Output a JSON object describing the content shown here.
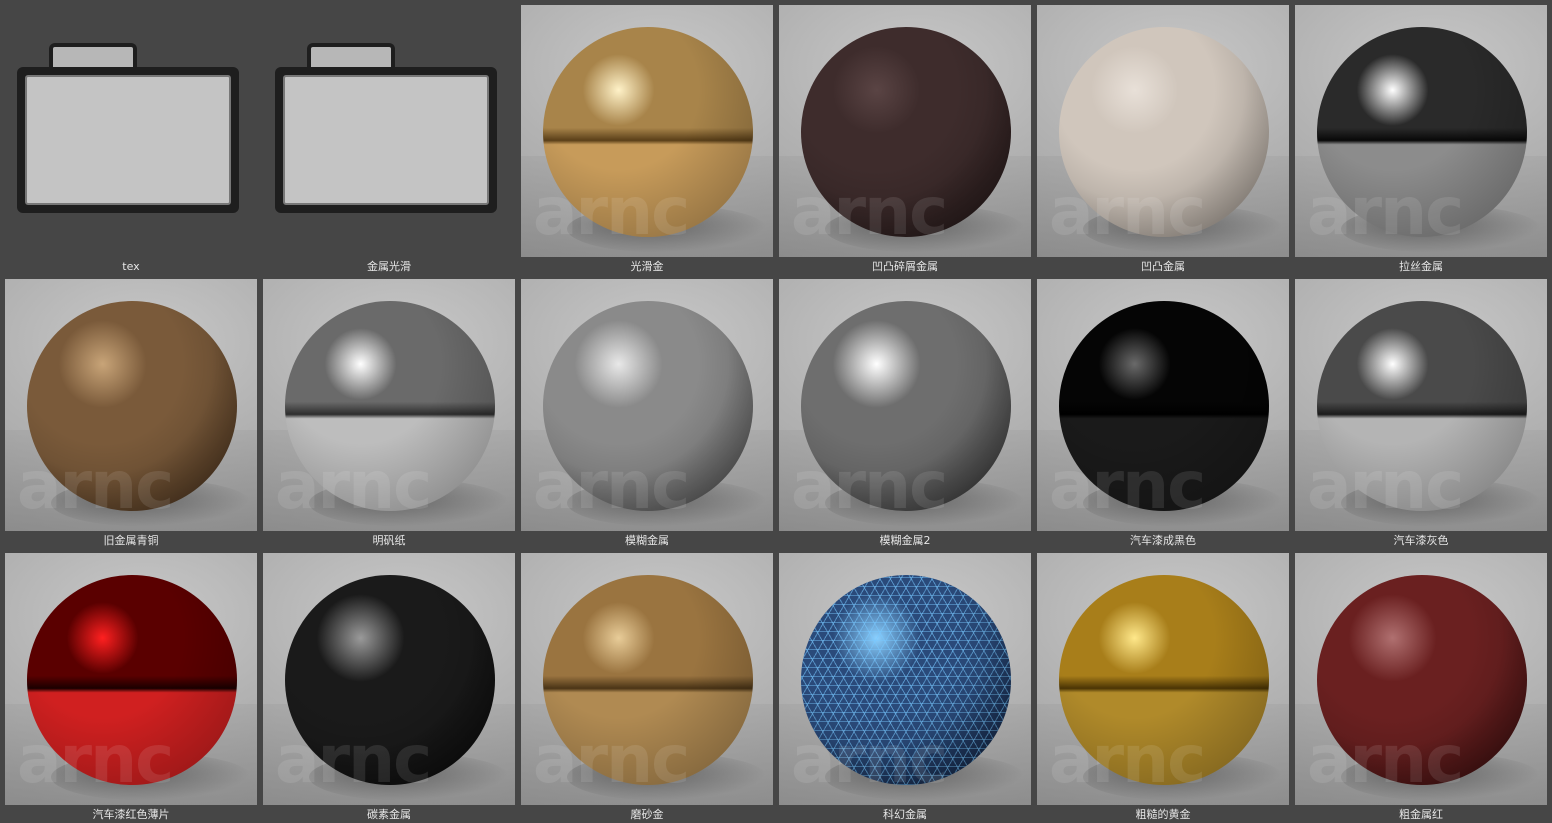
{
  "materials": [
    {
      "label": "tex",
      "kind": "folder",
      "icon": "folder-icon"
    },
    {
      "label": "金属光滑",
      "kind": "folder",
      "icon": "folder-icon"
    },
    {
      "label": "光滑金",
      "kind": "sphere",
      "base": "#a8844a",
      "dark": "#5a3f18",
      "hl": "#fff2c8",
      "bottom": "#c79b5a",
      "split": true
    },
    {
      "label": "凹凸碎屑金属",
      "kind": "sphere",
      "base": "#3e2c2c",
      "dark": "#1a1010",
      "hl": "#5a4444",
      "bottom": "#3e2c2c",
      "split": false
    },
    {
      "label": "凹凸金属",
      "kind": "sphere",
      "base": "#d0c6bc",
      "dark": "#8e867e",
      "hl": "#e8e0d8",
      "bottom": "#cfc5bb",
      "split": false
    },
    {
      "label": "拉丝金属",
      "kind": "sphere",
      "base": "#2a2a2a",
      "dark": "#080808",
      "hl": "#ffffff",
      "bottom": "#8c8c8c",
      "split": true
    },
    {
      "label": "旧金属青铜",
      "kind": "sphere",
      "base": "#7a5a3a",
      "dark": "#3a2614",
      "hl": "#c8a478",
      "bottom": "#6e5236",
      "split": false
    },
    {
      "label": "明矾纸",
      "kind": "sphere",
      "base": "#6a6a6a",
      "dark": "#2e2e2e",
      "hl": "#ffffff",
      "bottom": "#bdbdbd",
      "split": true
    },
    {
      "label": "模糊金属",
      "kind": "sphere",
      "base": "#8a8a8a",
      "dark": "#3c3c3c",
      "hl": "#e8e8e8",
      "bottom": "#8a8a8a",
      "split": false
    },
    {
      "label": "模糊金属2",
      "kind": "sphere",
      "base": "#6e6e6e",
      "dark": "#222222",
      "hl": "#ffffff",
      "bottom": "#7a7a7a",
      "split": false
    },
    {
      "label": "汽车漆成黑色",
      "kind": "sphere",
      "base": "#050505",
      "dark": "#000000",
      "hl": "#6a6a6a",
      "bottom": "#1a1a1a",
      "split": true
    },
    {
      "label": "汽车漆灰色",
      "kind": "sphere",
      "base": "#4a4a4a",
      "dark": "#1c1c1c",
      "hl": "#ffffff",
      "bottom": "#b4b4b4",
      "split": true
    },
    {
      "label": "汽车漆红色薄片",
      "kind": "sphere",
      "base": "#5a0000",
      "dark": "#1a0000",
      "hl": "#ff2020",
      "bottom": "#d02020",
      "split": true
    },
    {
      "label": "碳素金属",
      "kind": "sphere",
      "base": "#1a1a1a",
      "dark": "#050505",
      "hl": "#9a9a9a",
      "bottom": "#2a2a2a",
      "split": false
    },
    {
      "label": "磨砂金",
      "kind": "sphere",
      "base": "#9a7440",
      "dark": "#4a3416",
      "hl": "#e8cc98",
      "bottom": "#b08a52",
      "split": true
    },
    {
      "label": "科幻金属",
      "kind": "sphere",
      "base": "#2a4a7a",
      "dark": "#0a1428",
      "hl": "#8ad0ff",
      "bottom": "#2a4a7a",
      "split": false
    },
    {
      "label": "粗糙的黄金",
      "kind": "sphere",
      "base": "#a87e1a",
      "dark": "#4a3404",
      "hl": "#ffe88a",
      "bottom": "#b08a2a",
      "split": true
    },
    {
      "label": "粗金属红",
      "kind": "sphere",
      "base": "#6a2020",
      "dark": "#2a0808",
      "hl": "#b07070",
      "bottom": "#7a5050",
      "split": false
    }
  ],
  "watermark": "arnc"
}
